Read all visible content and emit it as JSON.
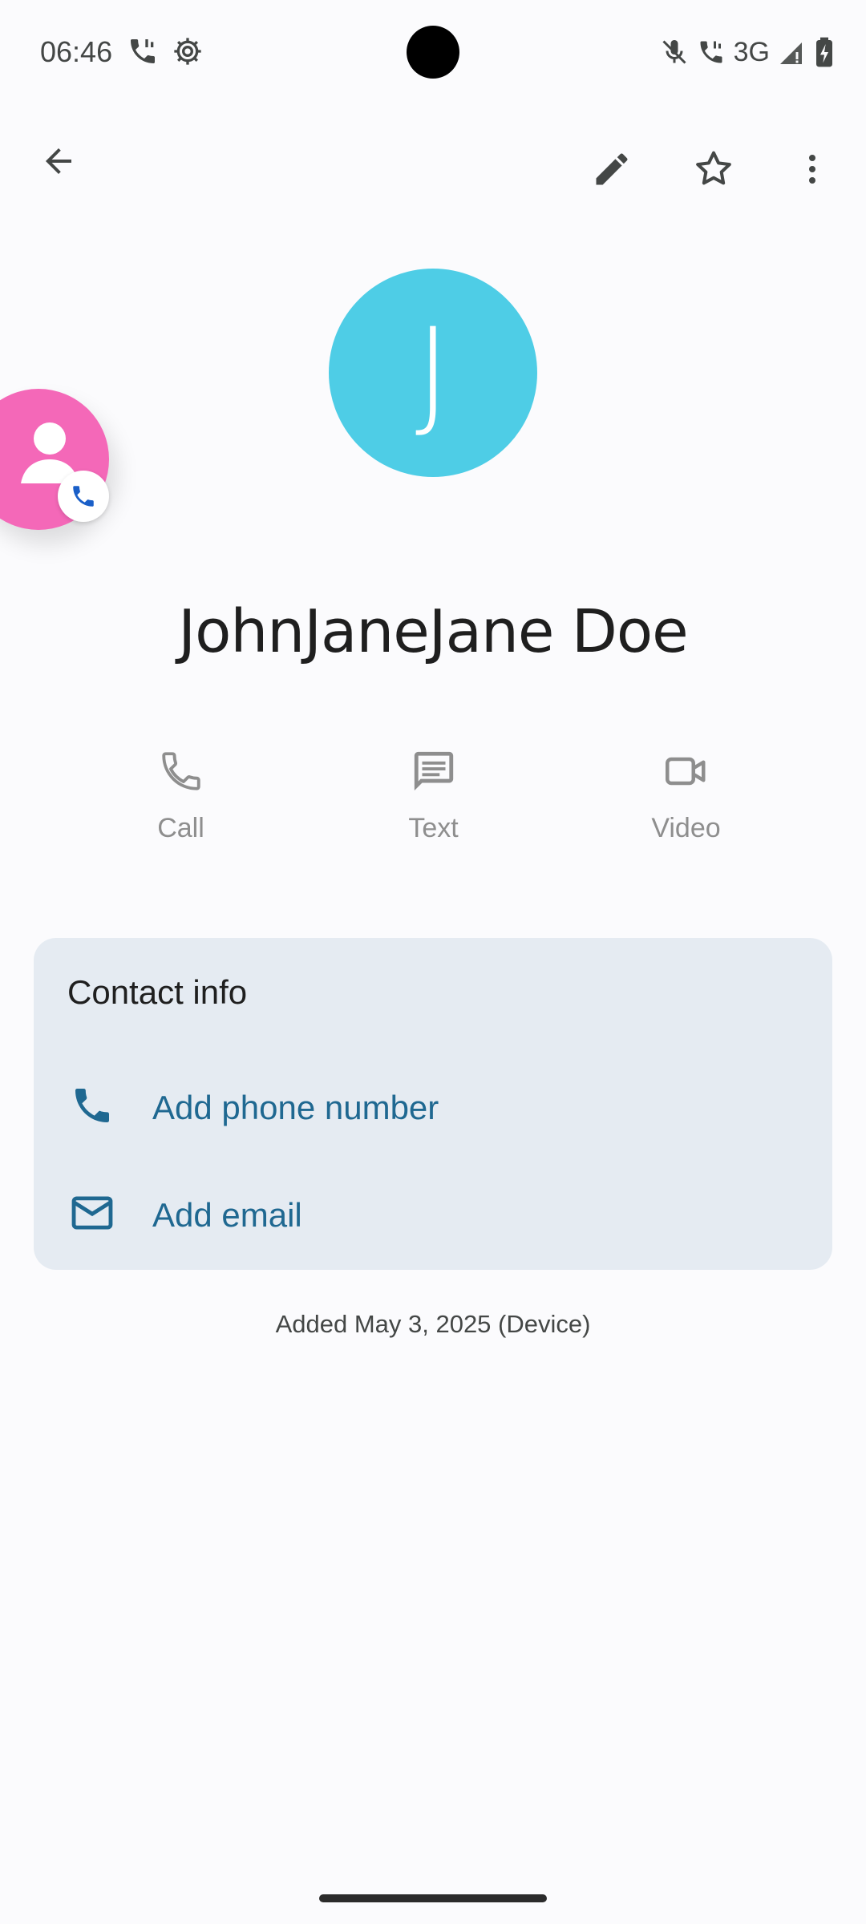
{
  "status_bar": {
    "time": "06:46",
    "network": "3G",
    "icons": [
      "wifi-call-icon",
      "settings-gear-icon",
      "mute-icon",
      "wifi-call-icon",
      "signal-icon",
      "battery-charging-icon"
    ]
  },
  "app_bar": {
    "icons": [
      "back-arrow-icon",
      "edit-pencil-icon",
      "star-icon",
      "more-vert-icon"
    ]
  },
  "contact": {
    "initial": "J",
    "name": "JohnJaneJane Doe",
    "avatar_color": "#4ecde6"
  },
  "actions": [
    {
      "label": "Call",
      "icon": "phone-icon"
    },
    {
      "label": "Text",
      "icon": "message-icon"
    },
    {
      "label": "Video",
      "icon": "video-icon"
    }
  ],
  "contact_info": {
    "title": "Contact info",
    "rows": [
      {
        "label": "Add phone number",
        "icon": "phone-icon"
      },
      {
        "label": "Add email",
        "icon": "email-icon"
      }
    ]
  },
  "added_text": "Added May 3, 2025 (Device)",
  "colors": {
    "background": "#fbfbfd",
    "card": "#e5ebf2",
    "accent_link": "#1f6891",
    "bubble": "#f468b8"
  }
}
